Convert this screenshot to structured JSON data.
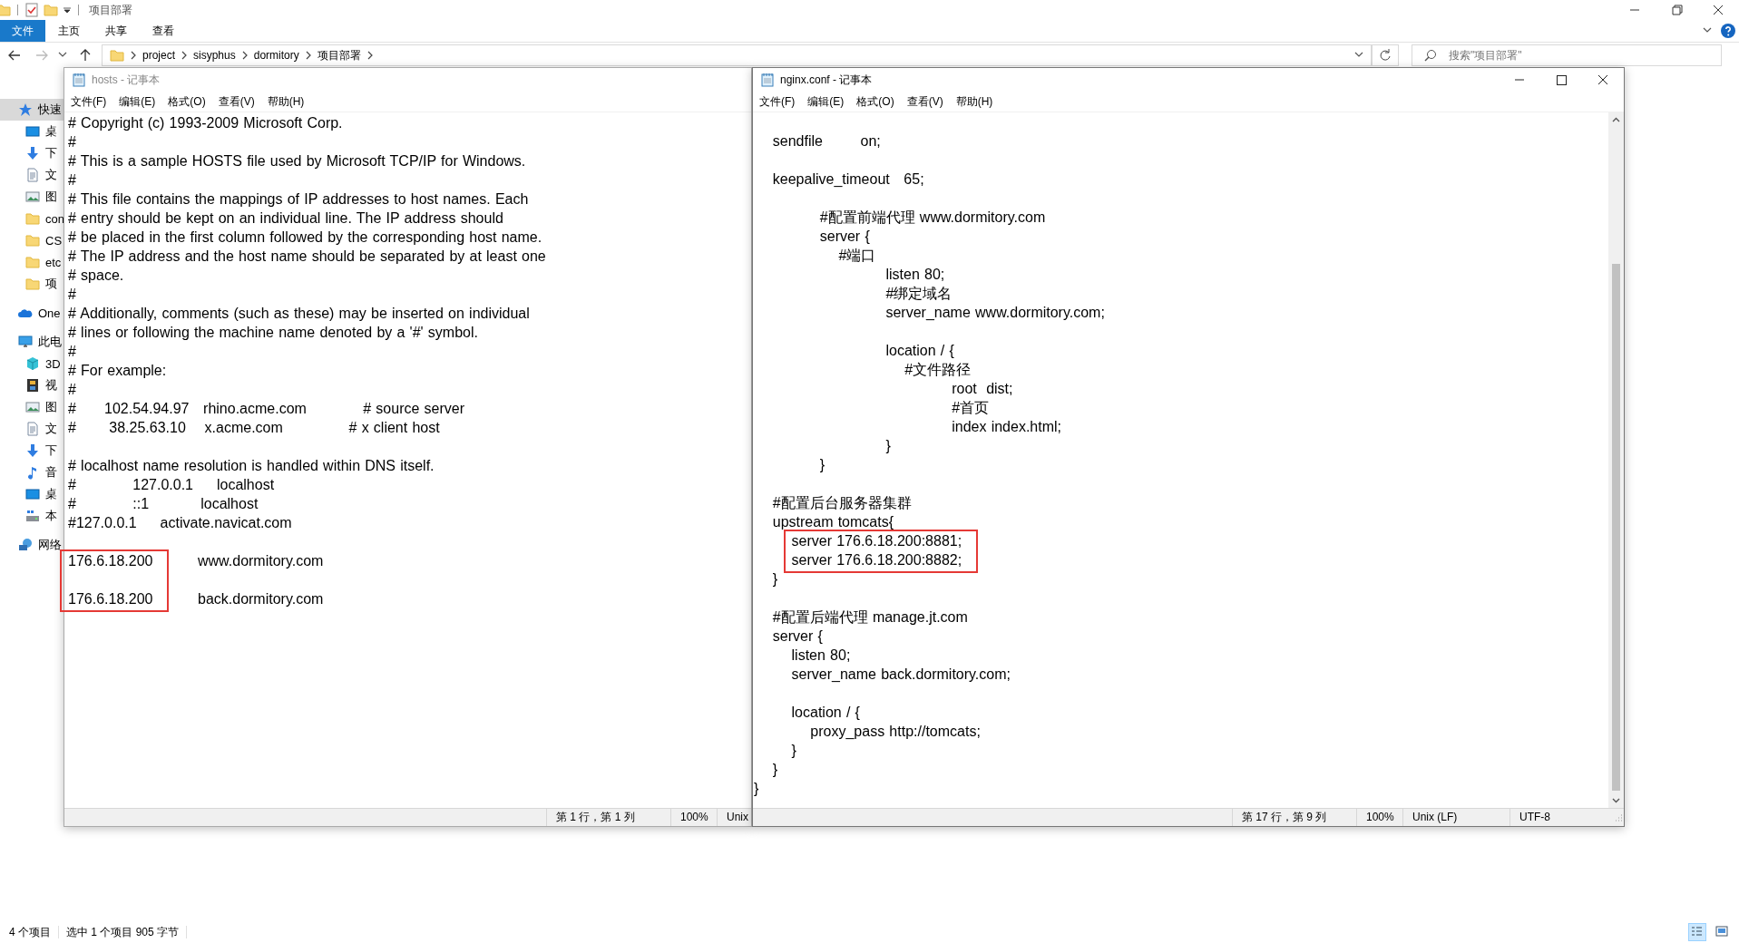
{
  "explorer": {
    "title": "项目部署",
    "ribbon_tabs": [
      {
        "label": "文件",
        "selected": true
      },
      {
        "label": "主页",
        "selected": false
      },
      {
        "label": "共享",
        "selected": false
      },
      {
        "label": "查看",
        "selected": false
      }
    ],
    "breadcrumb": [
      "project",
      "sisyphus",
      "dormitory",
      "项目部署"
    ],
    "search": {
      "placeholder": "搜索\"项目部署\""
    },
    "sidebar": {
      "items": [
        {
          "label": "快速",
          "kind": "quick",
          "selected": true,
          "children": [
            {
              "label": "桌",
              "kind": "desktop",
              "selected": false
            },
            {
              "label": "下",
              "kind": "downloads",
              "selected": false
            },
            {
              "label": "文",
              "kind": "documents",
              "selected": false
            },
            {
              "label": "图",
              "kind": "pictures",
              "selected": false
            },
            {
              "label": "con",
              "kind": "folder",
              "selected": false
            },
            {
              "label": "CS",
              "kind": "folder",
              "selected": false
            },
            {
              "label": "etc",
              "kind": "folder",
              "selected": false
            },
            {
              "label": "项",
              "kind": "folder",
              "selected": false
            }
          ]
        },
        {
          "label": "One",
          "kind": "cloud",
          "selected": false
        },
        {
          "label": "此电",
          "kind": "pc",
          "selected": false,
          "children": [
            {
              "label": "3D",
              "kind": "objects3d",
              "selected": false
            },
            {
              "label": "视",
              "kind": "videos",
              "selected": false
            },
            {
              "label": "图",
              "kind": "pictures",
              "selected": false
            },
            {
              "label": "文",
              "kind": "documents",
              "selected": false
            },
            {
              "label": "下",
              "kind": "downloads",
              "selected": false
            },
            {
              "label": "音",
              "kind": "music",
              "selected": false
            },
            {
              "label": "桌",
              "kind": "desktop",
              "selected": false
            },
            {
              "label": "本",
              "kind": "drive",
              "selected": false
            }
          ]
        },
        {
          "label": "网络",
          "kind": "network",
          "selected": false
        }
      ]
    },
    "status_bar": {
      "item_count": "4 个项目",
      "selection": "选中 1 个项目  905 字节"
    },
    "view_buttons": [
      {
        "kind": "details",
        "selected": true
      },
      {
        "kind": "tiles",
        "selected": false
      }
    ]
  },
  "notepads": [
    {
      "title": "hosts - 记事本",
      "active": false,
      "scrollbar": false,
      "menu": [
        "文件(F)",
        "编辑(E)",
        "格式(O)",
        "查看(V)",
        "帮助(H)"
      ],
      "lines": [
        {
          "kind": "line",
          "text": "# Copyright (c) 1993-2009 Microsoft Corp."
        },
        {
          "kind": "line",
          "text": "#"
        },
        {
          "kind": "line",
          "text": "# This is a sample HOSTS file used by Microsoft TCP/IP for Windows."
        },
        {
          "kind": "line",
          "text": "#"
        },
        {
          "kind": "line",
          "text": "# This file contains the mappings of IP addresses to host names. Each"
        },
        {
          "kind": "line",
          "text": "# entry should be kept on an individual line. The IP address should"
        },
        {
          "kind": "line",
          "text": "# be placed in the first column followed by the corresponding host name."
        },
        {
          "kind": "line",
          "text": "# The IP address and the host name should be separated by at least one"
        },
        {
          "kind": "line",
          "text": "# space."
        },
        {
          "kind": "line",
          "text": "#"
        },
        {
          "kind": "line",
          "text": "# Additionally, comments (such as these) may be inserted on individual"
        },
        {
          "kind": "line",
          "text": "# lines or following the machine name denoted by a '#' symbol."
        },
        {
          "kind": "line",
          "text": "#"
        },
        {
          "kind": "line",
          "text": "# For example:"
        },
        {
          "kind": "line",
          "text": "#"
        },
        {
          "kind": "line",
          "text": "#      102.54.94.97   rhino.acme.com            # source server"
        },
        {
          "kind": "line",
          "text": "#       38.25.63.10    x.acme.com              # x client host"
        },
        {
          "kind": "blank"
        },
        {
          "kind": "line",
          "text": "# localhost name resolution is handled within DNS itself."
        },
        {
          "kind": "line",
          "text": "#            127.0.0.1     localhost"
        },
        {
          "kind": "line",
          "text": "#            ::1           localhost"
        },
        {
          "kind": "line",
          "text": "#127.0.0.1     activate.navicat.com"
        },
        {
          "kind": "blank"
        },
        {
          "kind": "entry",
          "address": "176.6.18.200",
          "host": "www.dormitory.com",
          "highlighted": true
        },
        {
          "kind": "blank"
        },
        {
          "kind": "entry",
          "address": "176.6.18.200",
          "host": "back.dormitory.com",
          "highlighted": true
        }
      ],
      "status": [
        "第 1 行，第 1 列",
        "100%",
        "Unix"
      ]
    },
    {
      "title": "nginx.conf - 记事本",
      "active": true,
      "scrollbar": true,
      "menu": [
        "文件(F)",
        "编辑(E)",
        "格式(O)",
        "查看(V)",
        "帮助(H)"
      ],
      "lines": [
        {
          "kind": "line",
          "text": "    sendfile        on;"
        },
        {
          "kind": "blank"
        },
        {
          "kind": "line",
          "text": "    keepalive_timeout   65;"
        },
        {
          "kind": "blank"
        },
        {
          "kind": "line",
          "text": "              #配置前端代理 www.dormitory.com"
        },
        {
          "kind": "line",
          "text": "              server {"
        },
        {
          "kind": "line",
          "text": "                  #端口"
        },
        {
          "kind": "line",
          "text": "                            listen 80;"
        },
        {
          "kind": "line",
          "text": "                            #绑定域名"
        },
        {
          "kind": "line",
          "text": "                            server_name www.dormitory.com;"
        },
        {
          "kind": "blank"
        },
        {
          "kind": "line",
          "text": "                            location / {"
        },
        {
          "kind": "line",
          "text": "                                #文件路径"
        },
        {
          "kind": "line",
          "text": "                                          root  dist;"
        },
        {
          "kind": "line",
          "text": "                                          #首页"
        },
        {
          "kind": "line",
          "text": "                                          index index.html;"
        },
        {
          "kind": "line",
          "text": "                            }"
        },
        {
          "kind": "line",
          "text": "              }"
        },
        {
          "kind": "blank"
        },
        {
          "kind": "line",
          "text": "    #配置后台服务器集群"
        },
        {
          "kind": "line",
          "text": "    upstream tomcats{"
        },
        {
          "kind": "line",
          "text": "        server 176.6.18.200:8881;",
          "highlighted": true
        },
        {
          "kind": "line",
          "text": "        server 176.6.18.200:8882;",
          "highlighted": true
        },
        {
          "kind": "line",
          "text": "    }"
        },
        {
          "kind": "blank"
        },
        {
          "kind": "line",
          "text": "    #配置后端代理 manage.jt.com"
        },
        {
          "kind": "line",
          "text": "    server {"
        },
        {
          "kind": "line",
          "text": "        listen 80;"
        },
        {
          "kind": "line",
          "text": "        server_name back.dormitory.com;"
        },
        {
          "kind": "blank"
        },
        {
          "kind": "line",
          "text": "        location / {"
        },
        {
          "kind": "line",
          "text": "            proxy_pass http://tomcats;"
        },
        {
          "kind": "line",
          "text": "        }"
        },
        {
          "kind": "line",
          "text": "    }"
        },
        {
          "kind": "line",
          "text": "}"
        }
      ],
      "status": [
        "第 17 行，第 9 列",
        "100%",
        "Unix (LF)",
        "UTF-8"
      ]
    }
  ]
}
